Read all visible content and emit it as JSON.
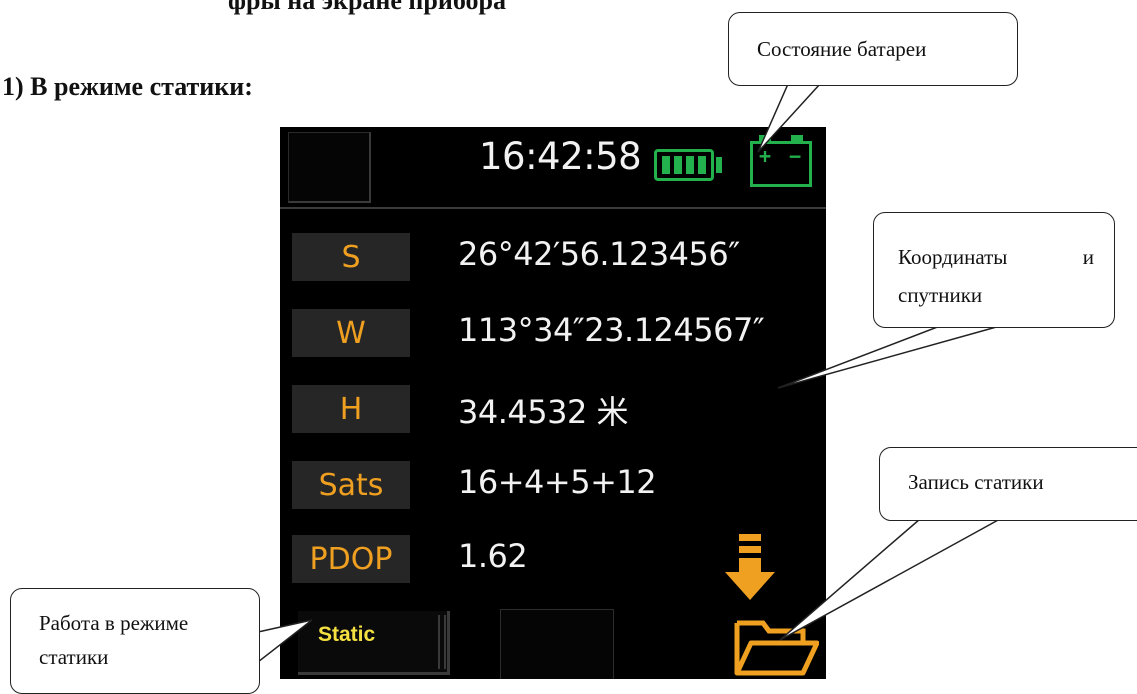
{
  "doc": {
    "heading_partial": "фры на экране прибора",
    "section_title": "1) В режиме статики:"
  },
  "device": {
    "time": "16:42:58",
    "battery_icon": "battery-full-icon",
    "charge_icon": "charging-battery-icon",
    "charge_plus": "+",
    "charge_minus": "−",
    "status_color": "#22b14c",
    "label_color": "#f0a020",
    "rows": [
      {
        "label": "S",
        "value": "26°42′56.123456″"
      },
      {
        "label": "W",
        "value": "113°34″23.124567″"
      },
      {
        "label": "H",
        "value": "34.4532 米"
      },
      {
        "label": "Sats",
        "value": "16+4+5+12"
      },
      {
        "label": "PDOP",
        "value": "1.62"
      }
    ],
    "static_button": "Static",
    "record_icon": "download-to-folder-icon"
  },
  "callouts": {
    "battery": "Состояние батареи",
    "coords_word1": "Координаты",
    "coords_word2": "и",
    "coords_line2": "спутники",
    "record": "Запись статики",
    "static_line1": "Работа в режиме",
    "static_line2": "статики"
  }
}
